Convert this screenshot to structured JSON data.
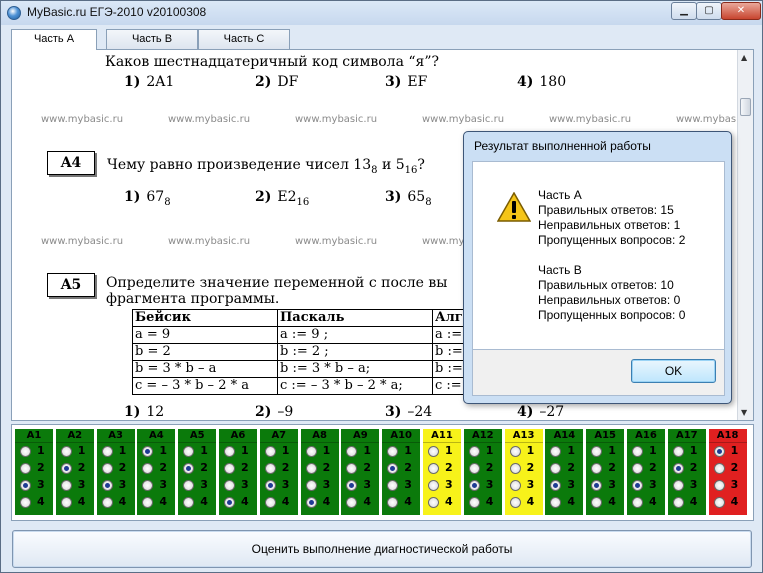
{
  "window": {
    "title": "MyBasic.ru ЕГЭ-2010 v20100308"
  },
  "tabs": [
    {
      "label": "Часть А"
    },
    {
      "label": "Часть В"
    },
    {
      "label": "Часть С"
    }
  ],
  "watermark": "www.mybasic.ru",
  "questions": {
    "a3": {
      "text": "Каков шестнадцатеричный код символа “я”?",
      "options": [
        {
          "num": "1)",
          "text": "2A1"
        },
        {
          "num": "2)",
          "text": "DF"
        },
        {
          "num": "3)",
          "text": "EF"
        },
        {
          "num": "4)",
          "text": "180"
        }
      ]
    },
    "a4": {
      "label": "A4",
      "text_prefix": "Чему равно произведение чисел 13",
      "sub1": "8",
      "text_mid": " и 5",
      "sub2": "16",
      "text_suffix": "?",
      "options": [
        {
          "num": "1)",
          "text": "67",
          "sub": "8"
        },
        {
          "num": "2)",
          "text": "E2",
          "sub": "16"
        },
        {
          "num": "3)",
          "text": "65",
          "sub": "8"
        }
      ]
    },
    "a5": {
      "label": "A5",
      "text_line1": "Определите значение переменной c после вы",
      "text_line2": "фрагмента программы.",
      "table_headers": [
        "Бейсик",
        "Паскаль",
        "Алг"
      ],
      "table_rows": [
        [
          "a = 9",
          "a := 9 ;",
          "a :="
        ],
        [
          "b = 2",
          "b := 2 ;",
          "b :="
        ],
        [
          "b = 3 * b – a",
          "b := 3 * b – a;",
          "b :="
        ],
        [
          "c = – 3 * b – 2 * a",
          "c := – 3 * b – 2 * a;",
          "c :="
        ]
      ],
      "options": [
        {
          "num": "1)",
          "text": "12"
        },
        {
          "num": "2)",
          "text": "–9"
        },
        {
          "num": "3)",
          "text": "–24"
        },
        {
          "num": "4)",
          "text": "–27"
        }
      ]
    }
  },
  "answer_sheet": {
    "colors": {
      "answered": "#0b7a0b",
      "skipped": "#f7f21a",
      "current": "#e02020"
    },
    "option_labels": [
      "1",
      "2",
      "3",
      "4"
    ],
    "columns": [
      {
        "label": "A1",
        "status": "answered",
        "selected": 3
      },
      {
        "label": "A2",
        "status": "answered",
        "selected": 2
      },
      {
        "label": "A3",
        "status": "answered",
        "selected": 3
      },
      {
        "label": "A4",
        "status": "answered",
        "selected": 1
      },
      {
        "label": "A5",
        "status": "answered",
        "selected": 2
      },
      {
        "label": "A6",
        "status": "answered",
        "selected": 4
      },
      {
        "label": "A7",
        "status": "answered",
        "selected": 3
      },
      {
        "label": "A8",
        "status": "answered",
        "selected": 4
      },
      {
        "label": "A9",
        "status": "answered",
        "selected": 3
      },
      {
        "label": "A10",
        "status": "answered",
        "selected": 2
      },
      {
        "label": "A11",
        "status": "skipped",
        "selected": 0
      },
      {
        "label": "A12",
        "status": "answered",
        "selected": 3
      },
      {
        "label": "A13",
        "status": "skipped",
        "selected": 0
      },
      {
        "label": "A14",
        "status": "answered",
        "selected": 3
      },
      {
        "label": "A15",
        "status": "answered",
        "selected": 3
      },
      {
        "label": "A16",
        "status": "answered",
        "selected": 3
      },
      {
        "label": "A17",
        "status": "answered",
        "selected": 2
      },
      {
        "label": "A18",
        "status": "current",
        "selected": 1
      }
    ]
  },
  "evaluate_button": "Оценить выполнение диагностической работы",
  "dialog": {
    "title": "Результат выполненной работы",
    "lines": [
      "Часть А",
      "Правильных ответов: 15",
      "Неправильных ответов: 1",
      "Пропущенных вопросов: 2",
      "",
      "Часть В",
      "Правильных ответов: 10",
      "Неправильных ответов: 0",
      "Пропущенных вопросов: 0"
    ],
    "ok_label": "OK"
  }
}
